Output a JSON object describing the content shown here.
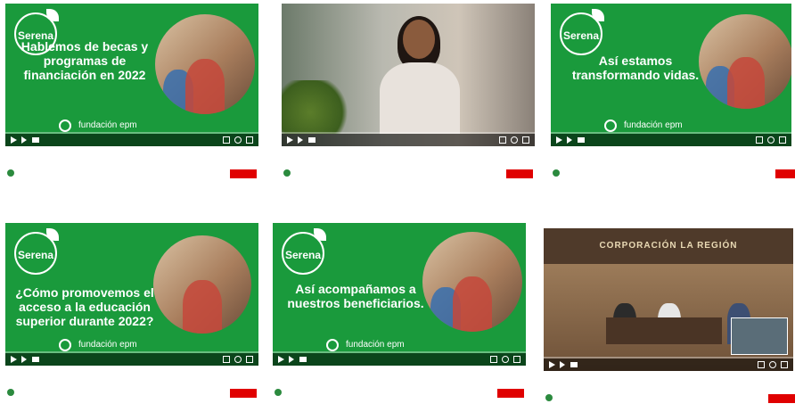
{
  "colors": {
    "brand_green": "#1a9a3c",
    "subscribe_red": "#e00000"
  },
  "icons": [
    "play-icon",
    "next-icon",
    "volume-icon",
    "captions-icon",
    "settings-icon",
    "fullscreen-icon"
  ],
  "cards": [
    {
      "logo": "Serena",
      "headline": "Hablemos de becas y programas de financiación en 2022",
      "brand": "fundación epm",
      "progress": 0
    },
    {
      "progress": 0
    },
    {
      "logo": "Serena",
      "headline": "Así estamos transformando vidas.",
      "brand": "fundación epm",
      "progress": 0
    },
    {
      "logo": "Serena",
      "headline": "¿Cómo promovemos el acceso a la educación superior durante 2022?",
      "brand": "fundación epm",
      "progress": 0
    },
    {
      "logo": "Serena",
      "headline": "Así acompañamos a nuestros beneficiarios.",
      "brand": "fundación epm",
      "progress": 0
    },
    {
      "room_sign": "CORPORACIÓN   LA   REGIÓN",
      "progress": 0
    }
  ]
}
